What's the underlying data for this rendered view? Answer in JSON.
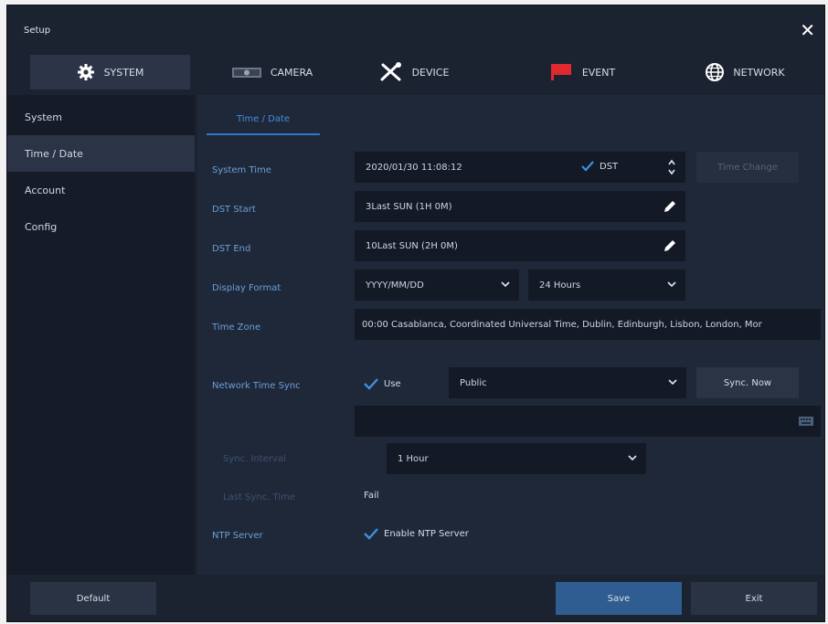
{
  "window": {
    "title": "Setup"
  },
  "tabs": [
    {
      "label": "SYSTEM",
      "icon": "gear-icon"
    },
    {
      "label": "CAMERA",
      "icon": "camera-icon"
    },
    {
      "label": "DEVICE",
      "icon": "tools-icon"
    },
    {
      "label": "EVENT",
      "icon": "flag-icon"
    },
    {
      "label": "NETWORK",
      "icon": "globe-icon"
    }
  ],
  "sidebar": {
    "items": [
      {
        "label": "System"
      },
      {
        "label": "Time / Date"
      },
      {
        "label": "Account"
      },
      {
        "label": "Config"
      }
    ]
  },
  "main": {
    "subtab": "Time / Date",
    "system_time": {
      "label": "System Time",
      "value": "2020/01/30 11:08:12",
      "dst_label": "DST",
      "dst_checked": true,
      "change_button": "Time Change"
    },
    "dst_start": {
      "label": "DST Start",
      "value": "3Last SUN (1H 0M)"
    },
    "dst_end": {
      "label": "DST End",
      "value": "10Last SUN (2H 0M)"
    },
    "display_format": {
      "label": "Display Format",
      "date_format": "YYYY/MM/DD",
      "hour_format": "24 Hours"
    },
    "time_zone": {
      "label": "Time Zone",
      "value": "00:00 Casablanca, Coordinated Universal Time, Dublin, Edinburgh, Lisbon, London, Mor"
    },
    "network_time_sync": {
      "label": "Network Time Sync",
      "use_label": "Use",
      "use_checked": true,
      "server_type": "Public",
      "sync_button": "Sync. Now",
      "server_address": ""
    },
    "sync_interval": {
      "label": "Sync. Interval",
      "value": "1 Hour"
    },
    "last_sync_time": {
      "label": "Last Sync. Time",
      "value": "Fail"
    },
    "ntp_server": {
      "label": "NTP Server",
      "enable_label": "Enable NTP Server",
      "checked": true
    }
  },
  "footer": {
    "default_label": "Default",
    "save_label": "Save",
    "exit_label": "Exit"
  },
  "colors": {
    "window_bg": "#1b2230",
    "content_bg": "#1f2838",
    "field_bg": "#131a26",
    "accent": "#3f8fe0",
    "label": "#6b9fd8",
    "save": "#2f5d92"
  }
}
